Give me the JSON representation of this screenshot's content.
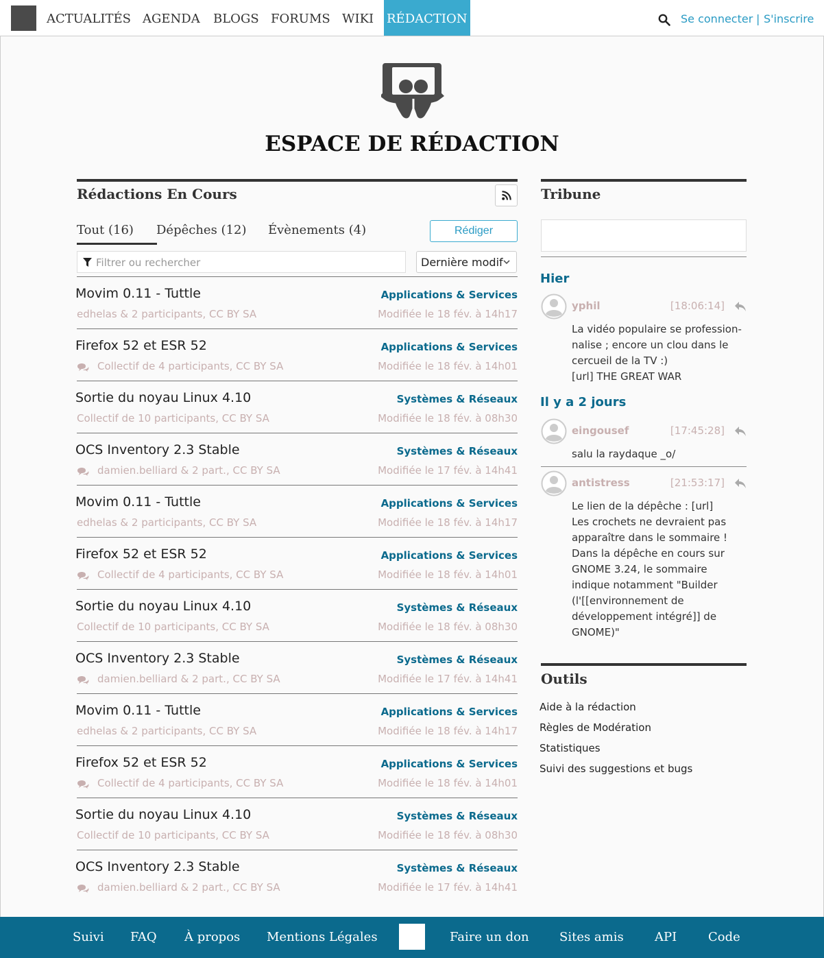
{
  "nav": {
    "items": [
      "ACTUALITÉS",
      "AGENDA",
      "BLOGS",
      "FORUMS",
      "WIKI",
      "RÉDACTION"
    ],
    "login": "Se connecter",
    "separator": "|",
    "register": "S'inscrire"
  },
  "page": {
    "title": "ESPACE DE RÉDACTION"
  },
  "redactions": {
    "title": "Rédactions En Cours",
    "tabs": [
      "Tout (16)",
      "Dépêches (12)",
      "Évènements (4)"
    ],
    "write_button": "Rédiger",
    "filter_placeholder": "Filtrer ou rechercher",
    "sort_value": "Dernière modif",
    "rows": [
      {
        "title": "Movim 0.11 - Tuttle",
        "category": "Applications & Services",
        "meta": "edhelas & 2 participants, CC BY SA",
        "date": "Modifiée le 18 fév. à 14h17"
      },
      {
        "title": "Firefox 52 et ESR 52",
        "category": "Applications & Services",
        "meta": "Collectif de 4 participants, CC BY SA",
        "date": "Modifiée le 18 fév. à 14h01"
      },
      {
        "title": "Sortie du noyau Linux 4.10",
        "category": "Systèmes & Réseaux",
        "meta": "Collectif de 10 participants, CC BY SA",
        "date": "Modifiée le 18 fév. à 08h30"
      },
      {
        "title": "OCS Inventory 2.3 Stable",
        "category": "Systèmes & Réseaux",
        "meta": "damien.belliard & 2 part., CC BY SA",
        "date": "Modifiée le 17 fév. à 14h41"
      },
      {
        "title": "Movim 0.11 - Tuttle",
        "category": "Applications & Services",
        "meta": "edhelas & 2 participants, CC BY SA",
        "date": "Modifiée le 18 fév. à 14h17"
      },
      {
        "title": "Firefox 52 et ESR 52",
        "category": "Applications & Services",
        "meta": "Collectif de 4 participants, CC BY SA",
        "date": "Modifiée le 18 fév. à 14h01"
      },
      {
        "title": "Sortie du noyau Linux 4.10",
        "category": "Systèmes & Réseaux",
        "meta": "Collectif de 10 participants, CC BY SA",
        "date": "Modifiée le 18 fév. à 08h30"
      },
      {
        "title": "OCS Inventory 2.3 Stable",
        "category": "Systèmes & Réseaux",
        "meta": "damien.belliard & 2 part., CC BY SA",
        "date": "Modifiée le 17 fév. à 14h41"
      },
      {
        "title": "Movim 0.11 - Tuttle",
        "category": "Applications & Services",
        "meta": "edhelas & 2 participants, CC BY SA",
        "date": "Modifiée le 18 fév. à 14h17"
      },
      {
        "title": "Firefox 52 et ESR 52",
        "category": "Applications & Services",
        "meta": "Collectif de 4 participants, CC BY SA",
        "date": "Modifiée le 18 fév. à 14h01"
      },
      {
        "title": "Sortie du noyau Linux 4.10",
        "category": "Systèmes & Réseaux",
        "meta": "Collectif de 10 participants, CC BY SA",
        "date": "Modifiée le 18 fév. à 08h30"
      },
      {
        "title": "OCS Inventory 2.3 Stable",
        "category": "Systèmes & Réseaux",
        "meta": "damien.belliard & 2 part., CC BY SA",
        "date": "Modifiée le 17 fév. à 14h41"
      }
    ]
  },
  "tribune": {
    "title": "Tribune",
    "days": [
      "Hier",
      "Il y a 2 jours"
    ],
    "messages": [
      {
        "nick": "yphil",
        "time": "[18:06:14]",
        "lines": [
          "La vidéo populaire se profession-",
          "nalise ; encore un clou dans le",
          "cercueil de la TV :)",
          "[url] THE GREAT WAR"
        ]
      },
      {
        "nick": "eingousef",
        "time": "[17:45:28]",
        "lines": [
          "salu la raydaque _o/"
        ]
      },
      {
        "nick": "antistress",
        "time": "[21:53:17]",
        "lines": [
          "Le lien de la dépêche : [url]",
          "Les crochets ne devraient pas",
          "apparaître dans le sommaire !",
          "Dans la dépêche en cours sur",
          "GNOME 3.24, le sommaire",
          "indique notamment \"Builder",
          "(l'[[environnement de",
          "développement intégré]] de",
          "GNOME)\""
        ]
      }
    ]
  },
  "outils": {
    "title": "Outils",
    "links": [
      "Aide à la rédaction",
      "Règles de Modération",
      "Statistiques",
      "Suivi des suggestions et bugs"
    ]
  },
  "footer": {
    "links": [
      "Suivi",
      "FAQ",
      "À propos",
      "Mentions Légales",
      "Faire un don",
      "Sites amis",
      "API",
      "Code"
    ]
  },
  "colors": {
    "accent": "#3aaacf",
    "link": "#2a9bc4",
    "category": "#0b6a8d",
    "footer_bg": "#0b6a8d",
    "muted": "#c8b0b0"
  }
}
